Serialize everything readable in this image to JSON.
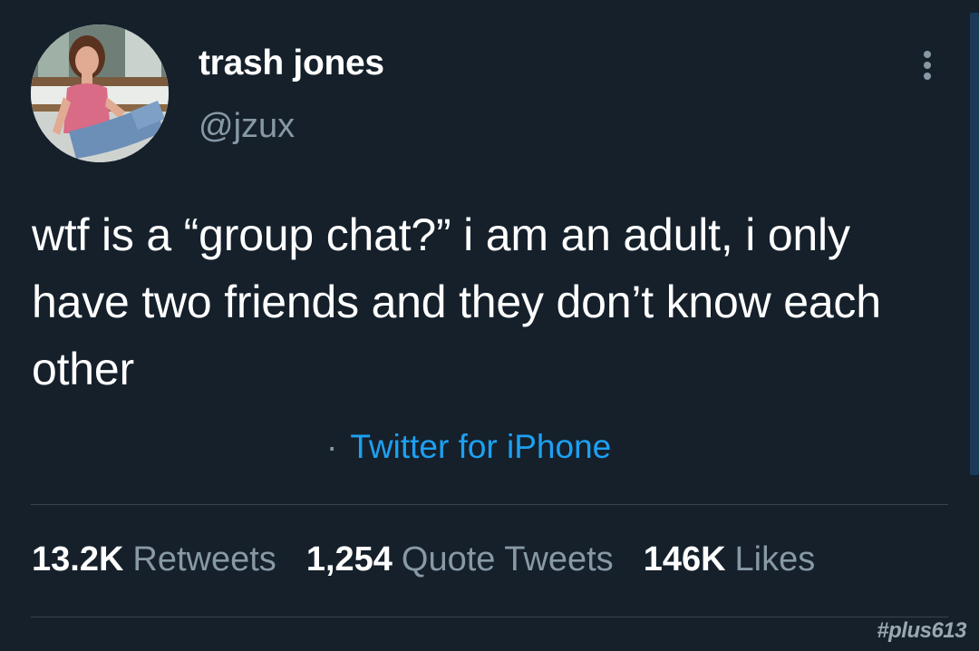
{
  "tweet": {
    "display_name": "trash jones",
    "handle": "@jzux",
    "text": "wtf is a “group chat?” i am an adult, i only have two friends and they don’t know each other",
    "source_separator": "·",
    "source": "Twitter for iPhone"
  },
  "stats": {
    "retweets_count": "13.2K",
    "retweets_label": "Retweets",
    "quotes_count": "1,254",
    "quotes_label": "Quote Tweets",
    "likes_count": "146K",
    "likes_label": "Likes"
  },
  "watermark": "#plus613",
  "icons": {
    "more": "more-vertical-icon",
    "avatar": "profile-photo"
  },
  "colors": {
    "background": "#15202b",
    "primary_text": "#ffffff",
    "secondary_text": "#8899a6",
    "link": "#1da1f2",
    "divider": "#38444d"
  }
}
